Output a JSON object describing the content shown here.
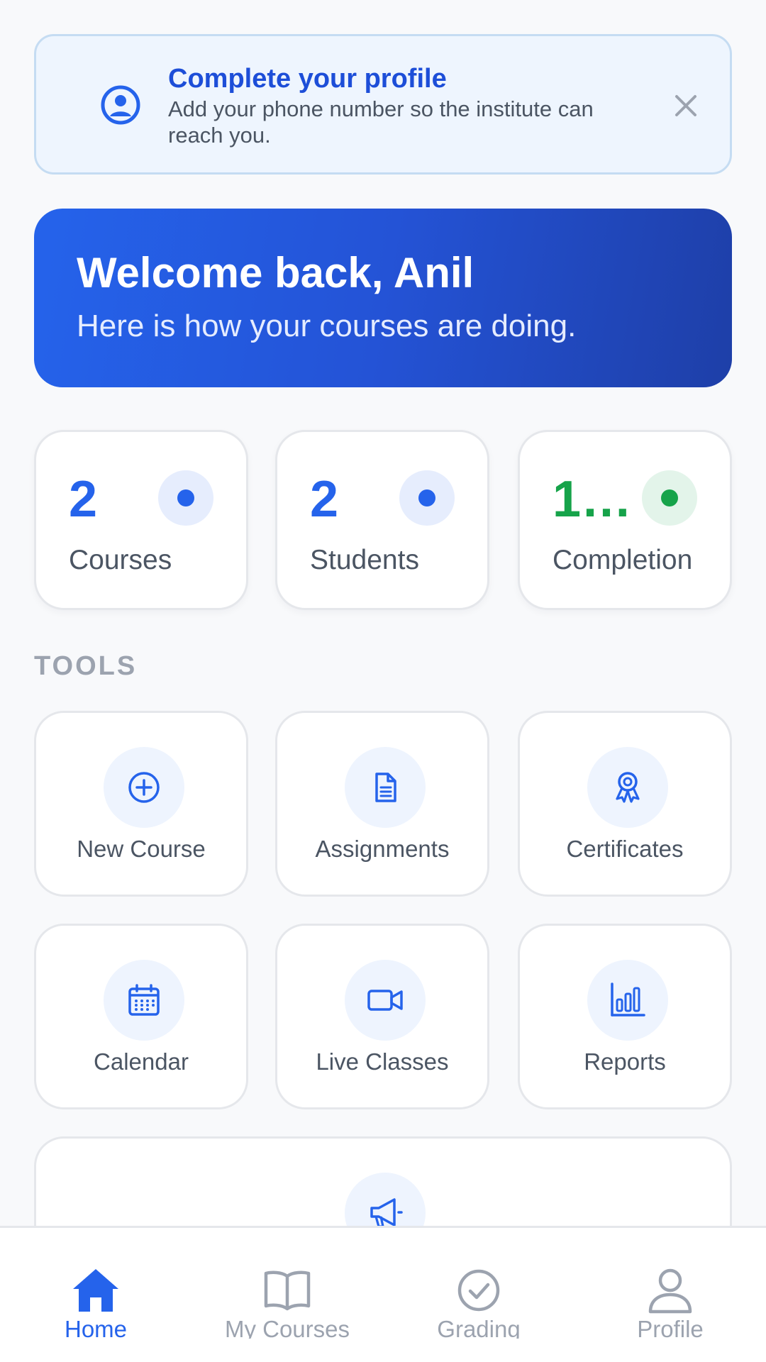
{
  "banner": {
    "title": "Complete your profile",
    "subtitle": "Add your phone number so the institute can reach you.",
    "icon": "user-circle-icon",
    "close_icon": "close-icon"
  },
  "hero": {
    "title": "Welcome back, Anil",
    "subtitle": "Here is how your courses are doing."
  },
  "stats": [
    {
      "value": "2",
      "label": "Courses",
      "color": "#2563eb",
      "dot_bg": "#e6edfd"
    },
    {
      "value": "2",
      "label": "Students",
      "color": "#2563eb",
      "dot_bg": "#e6edfd"
    },
    {
      "value": "1…",
      "label": "Completion",
      "color": "#16a34a",
      "dot_bg": "#e3f4ea"
    }
  ],
  "tools_section": {
    "label": "TOOLS"
  },
  "tools": [
    {
      "label": "New Course",
      "icon": "plus-circle-icon"
    },
    {
      "label": "Assignments",
      "icon": "document-icon"
    },
    {
      "label": "Certificates",
      "icon": "award-icon"
    },
    {
      "label": "Calendar",
      "icon": "calendar-icon"
    },
    {
      "label": "Live Classes",
      "icon": "video-camera-icon"
    },
    {
      "label": "Reports",
      "icon": "bar-chart-icon"
    },
    {
      "label": "",
      "icon": "megaphone-icon"
    }
  ],
  "nav": [
    {
      "label": "Home",
      "icon": "home-icon",
      "active": true
    },
    {
      "label": "My Courses",
      "icon": "book-open-icon",
      "active": false
    },
    {
      "label": "Grading",
      "icon": "check-circle-icon",
      "active": false
    },
    {
      "label": "Profile",
      "icon": "user-icon",
      "active": false
    }
  ],
  "colors": {
    "accent": "#2563eb",
    "success": "#16a34a",
    "muted": "#9ca3af"
  }
}
